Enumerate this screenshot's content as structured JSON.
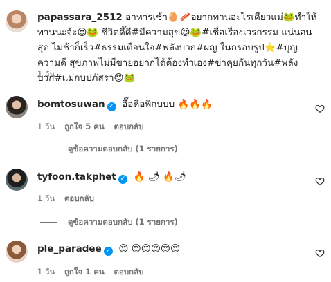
{
  "caption": {
    "username": "papassara_2512",
    "text": "อาหารเช้า🥚🥓อยากทานอะไรเดียวแม่🐸ทำให้ทานนะจ้ะ😍🐸 ชีวิตดี๊ดี#มีความสุข😍🐸#เชื่อเรื่องเวรกรรม แน่นอนสุด ไม่ช้าก็เร็ว#ธรรมเตือนใจ#พลังบวก#ผญ ในกรอบรูป⭐#บุญ ความดี สุขภาพไม่มีขายอยากได้ต้องทำเอง#ข่าคุยกันทุกวัน#พลังบวก#แม่กบปภัสรา😍🐸",
    "time": "1 วัน"
  },
  "comments": [
    {
      "username": "bomtosuwan",
      "text": "อื๊อหือพี่กบบบ 🔥🔥🔥",
      "time": "1 วัน",
      "likes": "ถูกใจ 5 คน",
      "reply": "ตอบกลับ",
      "view_replies": "ดูข้อความตอบกลับ (1 รายการ)"
    },
    {
      "username": "tyfoon.takphet",
      "text": "🔥 🌶 🔥🌶",
      "time": "1 วัน",
      "reply": "ตอบกลับ",
      "view_replies": "ดูข้อความตอบกลับ (1 รายการ)"
    },
    {
      "username": "ple_paradee",
      "text": "😍 😍😍😍😍😍",
      "time": "1 วัน",
      "likes": "ถูกใจ 1 คน",
      "reply": "ตอบกลับ"
    }
  ],
  "icons": {
    "verified": "verified-badge-icon",
    "like": "heart-outline-icon"
  },
  "colors": {
    "verified": "#0095f6",
    "meta_text": "#737373",
    "text": "#262626"
  }
}
